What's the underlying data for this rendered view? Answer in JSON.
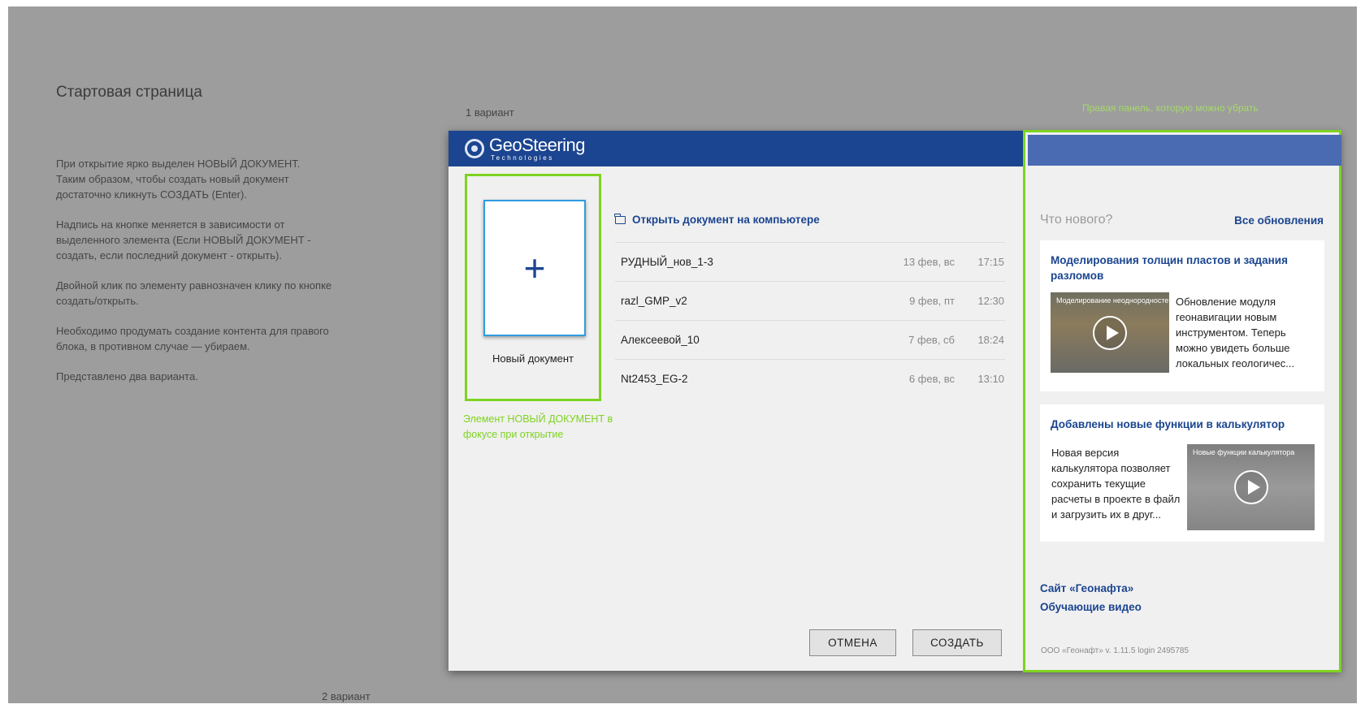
{
  "page": {
    "title": "Стартовая страница",
    "notes": [
      "При открытие ярко выделен НОВЫЙ ДОКУМЕНТ. Таким образом, чтобы создать новый документ достаточно кликнуть СОЗДАТЬ (Enter).",
      "Надпись на кнопке меняется в зависимости от выделенного элемента (Если НОВЫЙ ДОКУМЕНТ - создать, если последний документ - открыть).",
      "Двойной клик по элементу равнозначен клику по кнопке создать/открыть.",
      "Необходимо продумать создание контента для правого блока, в противном случае — убираем.",
      "Представлено два варианта."
    ],
    "variant1_label": "1 вариант",
    "variant2_label": "2 вариант",
    "right_panel_note": "Правая панель, которую можно убрать",
    "focus_note": "Элемент НОВЫЙ ДОКУМЕНТ в фокусе при открытие"
  },
  "dialog": {
    "logo": {
      "main": "GeoSteering",
      "sub": "Technologies"
    },
    "new_document": {
      "icon": "plus-icon",
      "label": "Новый документ"
    },
    "open_link": {
      "icon": "folder-icon",
      "label": "Открыть документ на компьютере"
    },
    "recent": [
      {
        "name": "РУДНЫЙ_нов_1-3",
        "date": "13 фев, вс",
        "time": "17:15"
      },
      {
        "name": "razl_GMP_v2",
        "date": "9 фев, пт",
        "time": "12:30"
      },
      {
        "name": "Алексеевой_10",
        "date": "7 фев, сб",
        "time": "18:24"
      },
      {
        "name": "Nt2453_EG-2",
        "date": "6 фев, вс",
        "time": "13:10"
      }
    ],
    "buttons": {
      "cancel": "ОТМЕНА",
      "create": "СОЗДАТЬ"
    }
  },
  "right_panel": {
    "header": "Что нового?",
    "all_updates": "Все обновления",
    "news": [
      {
        "title": "Моделирования толщин пластов и задания разломов",
        "thumb_caption": "Моделирование неоднородносте...",
        "description": "Обновление модуля геонавигации новым инструментом. Теперь можно увидеть больше локальных геологичес..."
      },
      {
        "title": "Добавлены новые функции в калькулятор",
        "thumb_caption": "Новые функции калькулятора",
        "description": "Новая версия калькулятора позволяет сохранить текущие расчеты в проекте в файл и загрузить их в друг..."
      }
    ],
    "links": [
      "Сайт «Геонафта»",
      "Обучающие видео"
    ],
    "version": "ООО «Геонафт» v. 1.11.5 login 2495785"
  },
  "colors": {
    "canvas": "#9d9d9d",
    "header_blue": "#1b4590",
    "annotation_green": "#7ed321",
    "link_blue": "#1b4590"
  }
}
